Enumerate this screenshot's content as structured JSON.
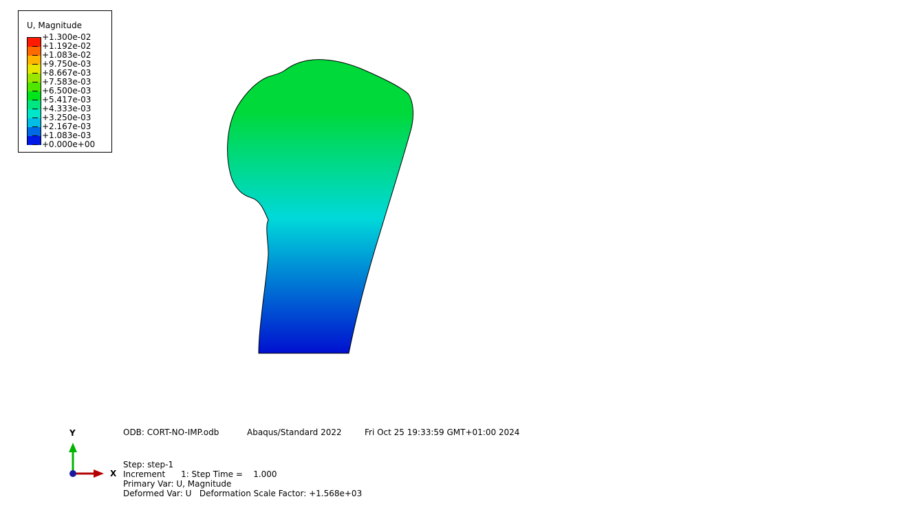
{
  "legend": {
    "title": "U, Magnitude",
    "labels": [
      "+1.300e-02",
      "+1.192e-02",
      "+1.083e-02",
      "+9.750e-03",
      "+8.667e-03",
      "+7.583e-03",
      "+6.500e-03",
      "+5.417e-03",
      "+4.333e-03",
      "+3.250e-03",
      "+2.167e-03",
      "+1.083e-03",
      "+0.000e+00"
    ],
    "band_colors": [
      "#ff1a00",
      "#ff6a00",
      "#ffb400",
      "#e6e600",
      "#9ae600",
      "#4fe600",
      "#00e61a",
      "#00e680",
      "#00e6c8",
      "#00bee6",
      "#006ae6",
      "#0019e6"
    ]
  },
  "model": {
    "color_top": "#00d93a",
    "color_mid": "#00d9d9",
    "color_bottom": "#0010d0"
  },
  "triad": {
    "y_label": "Y",
    "x_label": "X",
    "y_color": "#00b400",
    "x_color": "#b40000",
    "origin_color": "#1a1aa0"
  },
  "info": {
    "odb": "ODB: CORT-NO-IMP.odb",
    "solver": "Abaqus/Standard 2022",
    "datetime": "Fri Oct 25 19:33:59 GMT+01:00 2024",
    "step": "Step: step-1",
    "increment": "Increment      1: Step Time =    1.000",
    "primary_var": "Primary Var: U, Magnitude",
    "deformed_var": "Deformed Var: U   Deformation Scale Factor: +1.568e+03"
  }
}
